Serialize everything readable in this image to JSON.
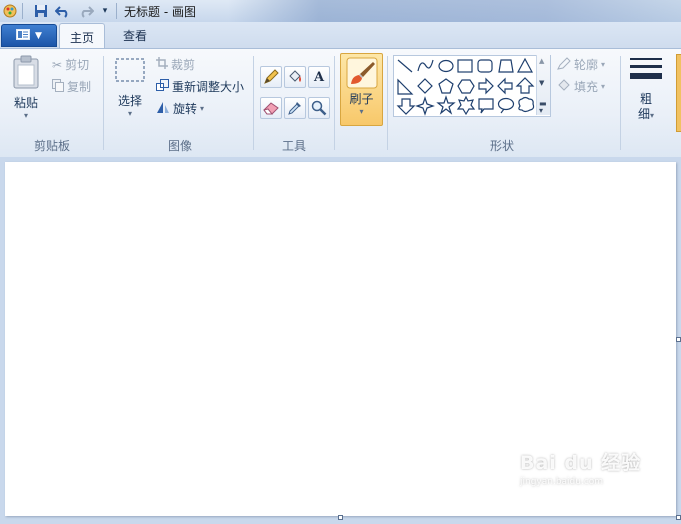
{
  "window": {
    "title": "无标题 - 画图"
  },
  "tabs": [
    {
      "label": "主页"
    },
    {
      "label": "查看"
    }
  ],
  "clipboard": {
    "paste": "粘贴",
    "cut": "剪切",
    "copy": "复制",
    "group": "剪贴板"
  },
  "image": {
    "select": "选择",
    "crop": "裁剪",
    "resize": "重新调整大小",
    "rotate": "旋转",
    "group": "图像"
  },
  "tools": {
    "group": "工具"
  },
  "brushes": {
    "label": "刷子"
  },
  "shapes": {
    "outline": "轮廓",
    "fill": "填充",
    "group": "形状"
  },
  "size": {
    "label1": "粗",
    "label2": "细"
  },
  "watermark": {
    "brand": "Bai du 经验",
    "url": "jingyan.baidu.com"
  },
  "colors": {
    "accent": "#1c55a8",
    "brush_bg": "#fbd27b",
    "canvas": "#ffffff"
  }
}
